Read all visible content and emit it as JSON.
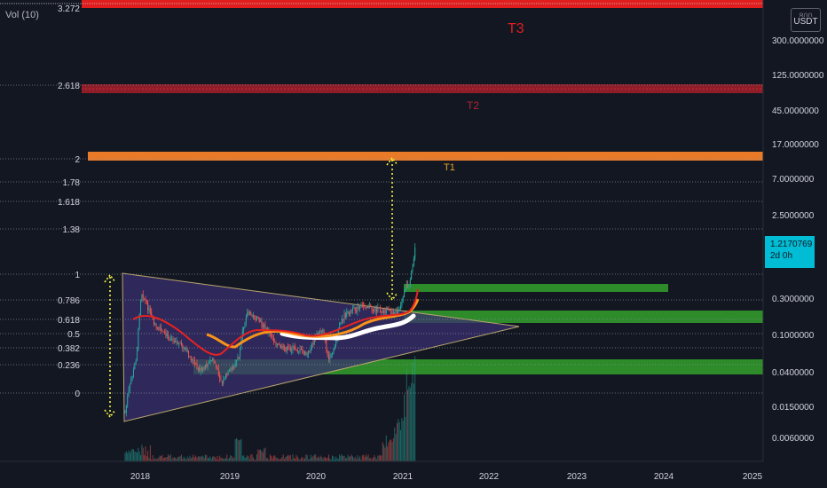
{
  "indicator_label": "Vol (10)",
  "currency": {
    "top": "800",
    "name": "USDT"
  },
  "last_price": {
    "value": "1.2170769",
    "countdown": "2d 0h"
  },
  "colors": {
    "background": "#131722",
    "candle_up": "#26a69a",
    "candle_down": "#ef5350",
    "t3": "#e01e1e",
    "t2": "#a01e2a",
    "t1": "#e87a28",
    "support_zone": "#2e8b2a",
    "triangle_fill": "#3a2f6e",
    "triangle_edge": "#b8a66e",
    "ma_red": "#e52222",
    "ma_orange": "#f7931a",
    "ma_white": "#ffffff",
    "projection": "#f5f542",
    "accent": "#00bcd4"
  },
  "chart_data": {
    "type": "candlestick",
    "x_axis": {
      "ticks": [
        "2018",
        "2019",
        "2020",
        "2021",
        "2022",
        "2023",
        "2024",
        "2025"
      ]
    },
    "y_axis": {
      "scale": "log",
      "ticks": [
        "300.0000000",
        "125.0000000",
        "45.0000000",
        "17.0000000",
        "7.0000000",
        "2.5000000",
        "0.3000000",
        "0.1000000",
        "0.0400000",
        "0.0150000",
        "0.0060000"
      ]
    },
    "fib_levels": [
      {
        "label": "3.272",
        "dashed": false
      },
      {
        "label": "2.618",
        "dashed": true
      },
      {
        "label": "2",
        "dashed": true
      },
      {
        "label": "1.78",
        "dashed": true
      },
      {
        "label": "1.618",
        "dashed": true
      },
      {
        "label": "1.38",
        "dashed": true
      },
      {
        "label": "1",
        "dashed": true
      },
      {
        "label": "0.786",
        "dashed": true
      },
      {
        "label": "0.618",
        "dashed": true
      },
      {
        "label": "0.5",
        "dashed": true
      },
      {
        "label": "0.382",
        "dashed": true
      },
      {
        "label": "0.236",
        "dashed": true
      },
      {
        "label": "0",
        "dashed": true
      }
    ],
    "targets": [
      "T3",
      "T2",
      "T1"
    ]
  }
}
